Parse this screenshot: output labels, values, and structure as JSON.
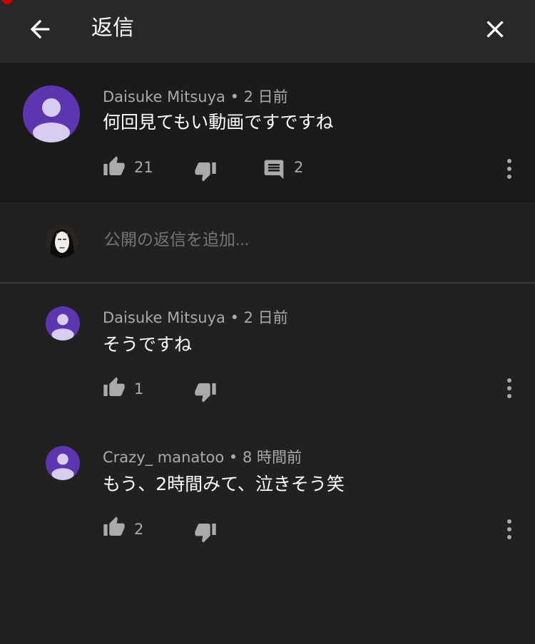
{
  "header": {
    "title": "返信"
  },
  "parent_comment": {
    "author": "Daisuke Mitsuya",
    "separator": "•",
    "time": "2 日前",
    "text": "何回見てもい動画ですですね",
    "likes": "21",
    "replies": "2"
  },
  "reply_box": {
    "placeholder": "公開の返信を追加..."
  },
  "replies": [
    {
      "author": "Daisuke Mitsuya",
      "separator": "•",
      "time": "2 日前",
      "text": "そうですね",
      "likes": "1"
    },
    {
      "author": "Crazy_ manatoo",
      "separator": "•",
      "time": "8 時間前",
      "text": "もう、2時間みて、泣きそう笑",
      "likes": "2"
    }
  ],
  "colors": {
    "background": "#212121",
    "header": "#282828",
    "parent_background": "#1b1b1b",
    "avatar": "#5e35b1",
    "secondary_text": "#aaaaaa"
  },
  "icons": {
    "back": "arrow-back-icon",
    "close": "close-icon",
    "like": "thumb-up-icon",
    "dislike": "thumb-down-icon",
    "reply": "comment-icon",
    "more": "more-vert-icon"
  }
}
